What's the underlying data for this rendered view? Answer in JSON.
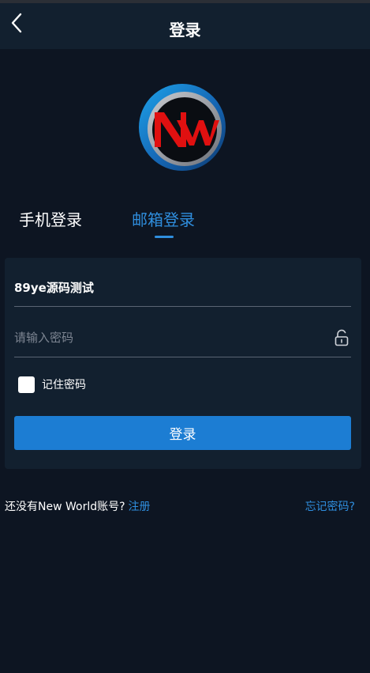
{
  "header": {
    "title": "登录",
    "back_icon": "chevron-left-icon"
  },
  "logo": {
    "icon": "new-world-logo",
    "letters": "Nw",
    "colors": {
      "ring": "#1b8fd8",
      "ring_inner": "#8a8d92",
      "letters": "#e01010"
    }
  },
  "tabs": [
    {
      "label": "手机登录",
      "active": false
    },
    {
      "label": "邮箱登录",
      "active": true
    }
  ],
  "form": {
    "account_value": "89ye源码测试",
    "password_placeholder": "请输入密码",
    "password_value": "",
    "lock_icon": "unlock-icon",
    "remember_label": "记住密码",
    "remember_checked": false,
    "login_button": "登录"
  },
  "footer": {
    "no_account_text": "还没有New World账号?",
    "register_link": "注册",
    "forgot_link": "忘记密码?"
  },
  "colors": {
    "background": "#0d1522",
    "panel": "#12202f",
    "accent": "#1c7dd3",
    "link": "#2f8ede"
  }
}
